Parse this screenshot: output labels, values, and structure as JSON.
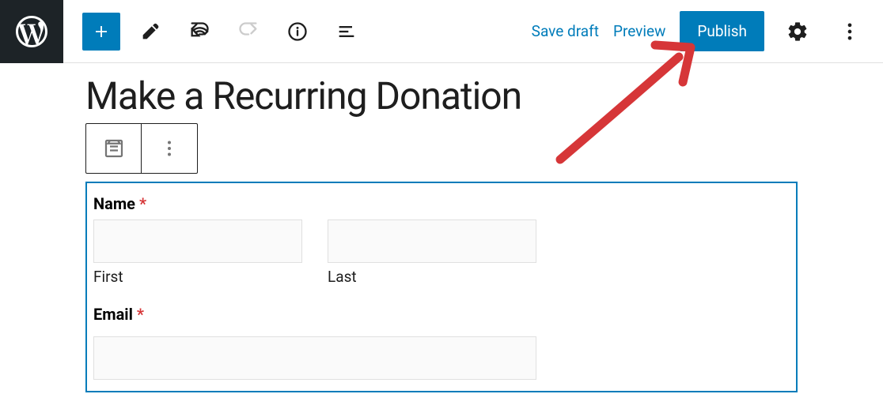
{
  "toolbar": {
    "save_draft_label": "Save draft",
    "preview_label": "Preview",
    "publish_label": "Publish"
  },
  "page": {
    "title": "Make a Recurring Donation"
  },
  "form": {
    "name_label": "Name",
    "name_required": "*",
    "first_sublabel": "First",
    "last_sublabel": "Last",
    "first_value": "",
    "last_value": "",
    "email_label": "Email",
    "email_required": "*",
    "email_value": ""
  }
}
